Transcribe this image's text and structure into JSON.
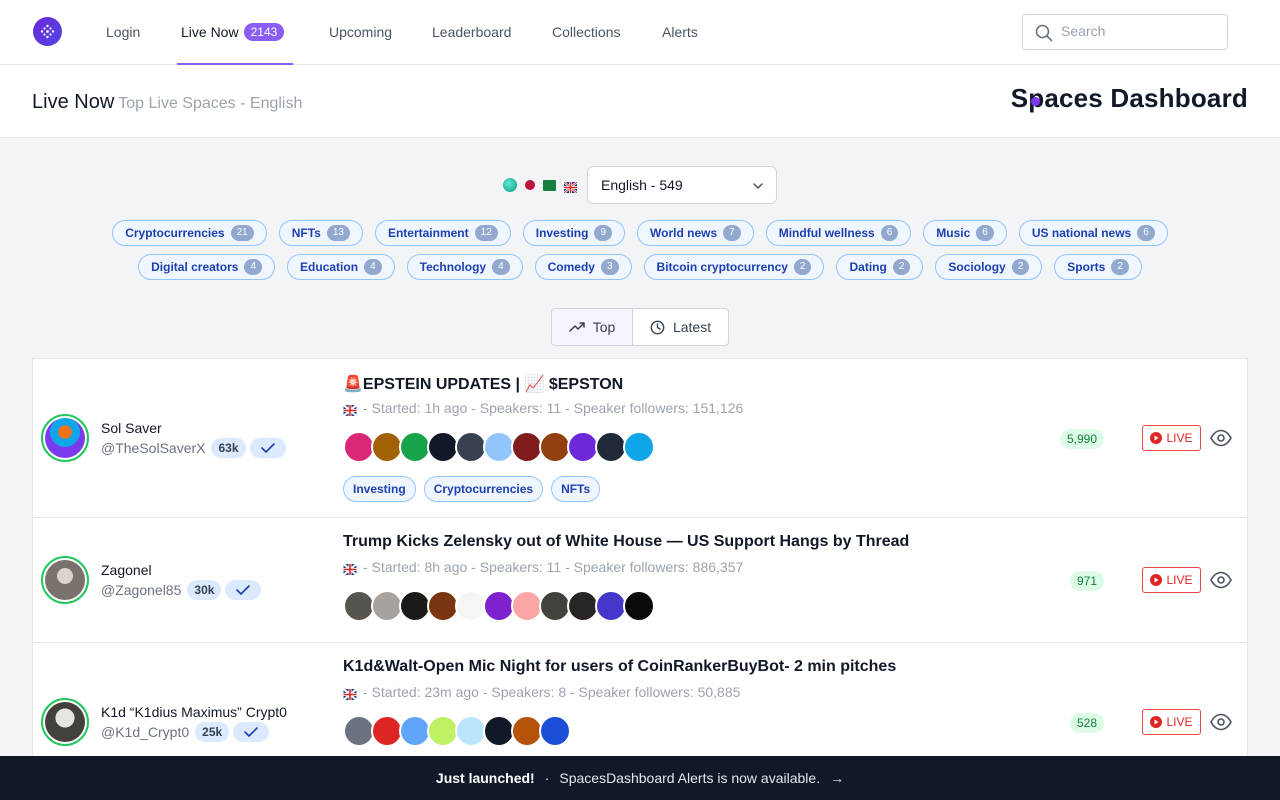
{
  "nav": {
    "items": [
      "Login",
      "Live Now",
      "Upcoming",
      "Leaderboard",
      "Collections",
      "Alerts"
    ],
    "live_count": "2143",
    "search_placeholder": "Search"
  },
  "header": {
    "title": "Live Now",
    "subtitle": "Top Live Spaces - English",
    "brand": "Spaces Dashboard"
  },
  "language": {
    "selected": "English - 549"
  },
  "topics": {
    "row1": [
      {
        "label": "Cryptocurrencies",
        "count": "21"
      },
      {
        "label": "NFTs",
        "count": "13"
      },
      {
        "label": "Entertainment",
        "count": "12"
      },
      {
        "label": "Investing",
        "count": "9"
      },
      {
        "label": "World news",
        "count": "7"
      },
      {
        "label": "Mindful wellness",
        "count": "6"
      },
      {
        "label": "Music",
        "count": "6"
      },
      {
        "label": "US national news",
        "count": "6"
      }
    ],
    "row2": [
      {
        "label": "Digital creators",
        "count": "4"
      },
      {
        "label": "Education",
        "count": "4"
      },
      {
        "label": "Technology",
        "count": "4"
      },
      {
        "label": "Comedy",
        "count": "3"
      },
      {
        "label": "Bitcoin cryptocurrency",
        "count": "2"
      },
      {
        "label": "Dating",
        "count": "2"
      },
      {
        "label": "Sociology",
        "count": "2"
      },
      {
        "label": "Sports",
        "count": "2"
      }
    ]
  },
  "sort": {
    "top": "Top",
    "latest": "Latest"
  },
  "spaces": [
    {
      "host_name": "Sol Saver",
      "handle": "@TheSolSaverX",
      "followers": "63k",
      "title": "🚨EPSTEIN UPDATES | 📈 $EPSTON",
      "meta": "- Started: 1h ago - Speakers: 11 - Speaker followers: 151,126",
      "listeners": "5,990",
      "tags": [
        "Investing",
        "Cryptocurrencies",
        "NFTs"
      ],
      "live": "LIVE"
    },
    {
      "host_name": "Zagonel",
      "handle": "@Zagonel85",
      "followers": "30k",
      "title": "Trump Kicks Zelensky out of White House — US Support Hangs by Thread",
      "meta": "- Started: 8h ago - Speakers: 11 - Speaker followers: 886,357",
      "listeners": "971",
      "tags": [],
      "live": "LIVE"
    },
    {
      "host_name": "K1d “K1dius Maximus” Crypt0",
      "handle": "@K1d_Crypt0",
      "followers": "25k",
      "title": "K1d&Walt-Open Mic Night for users of CoinRankerBuyBot- 2 min pitches",
      "meta": "- Started: 23m ago - Speakers: 8 - Speaker followers: 50,885",
      "listeners": "528",
      "tags": [],
      "live": "LIVE"
    }
  ],
  "banner": {
    "highlight": "Just launched!",
    "separator": "·",
    "message": "SpacesDashboard Alerts is now available.",
    "arrow": "→"
  }
}
